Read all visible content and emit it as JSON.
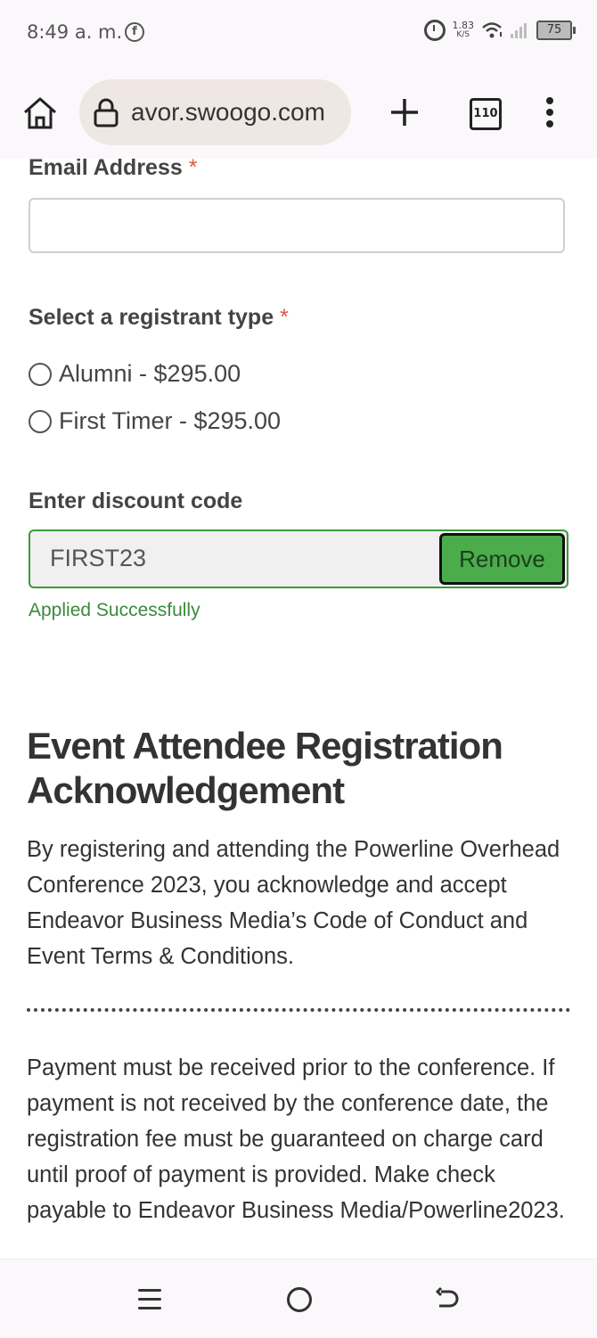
{
  "status_bar": {
    "time": "8:49 a. m.",
    "net_speed_value": "1.83",
    "net_speed_unit": "K/S",
    "battery": "75",
    "icons": [
      "facebook-icon",
      "alarm-icon",
      "wifi-icon",
      "signal-icon",
      "battery-icon"
    ]
  },
  "browser": {
    "url": "avor.swoogo.com",
    "tab_count": "110",
    "icons": [
      "home-icon",
      "lock-icon",
      "plus-icon",
      "tabs-icon",
      "more-vert-icon"
    ]
  },
  "form": {
    "email_label": "Email Address",
    "required_mark": "*",
    "email_value": "",
    "registrant_label": "Select a registrant type",
    "options": [
      {
        "label": "Alumni - $295.00",
        "selected": false
      },
      {
        "label": "First Timer - $295.00",
        "selected": false
      }
    ],
    "discount_label": "Enter discount code",
    "discount_value": "FIRST23",
    "remove_label": "Remove",
    "applied_message": "Applied Successfully"
  },
  "acknowledgement": {
    "title": "Event Attendee Registration Acknowledgement",
    "paragraph1": "By registering and attending the Powerline Overhead Conference 2023, you acknowledge and accept Endeavor Business Media’s Code of Conduct and Event Terms & Conditions.",
    "paragraph2": "Payment must be received prior to the conference. If payment is not received by the conference date, the registration fee must be guaranteed on charge card until proof of payment is provided. Make check payable to Endeavor Business Media/Powerline2023."
  },
  "colors": {
    "accent_green": "#4aac4a",
    "success_text": "#3a8a3a",
    "required_red": "#e05a3a"
  },
  "nav_bar": {
    "icons": [
      "recent-apps-icon",
      "home-circle-icon",
      "back-icon"
    ]
  }
}
